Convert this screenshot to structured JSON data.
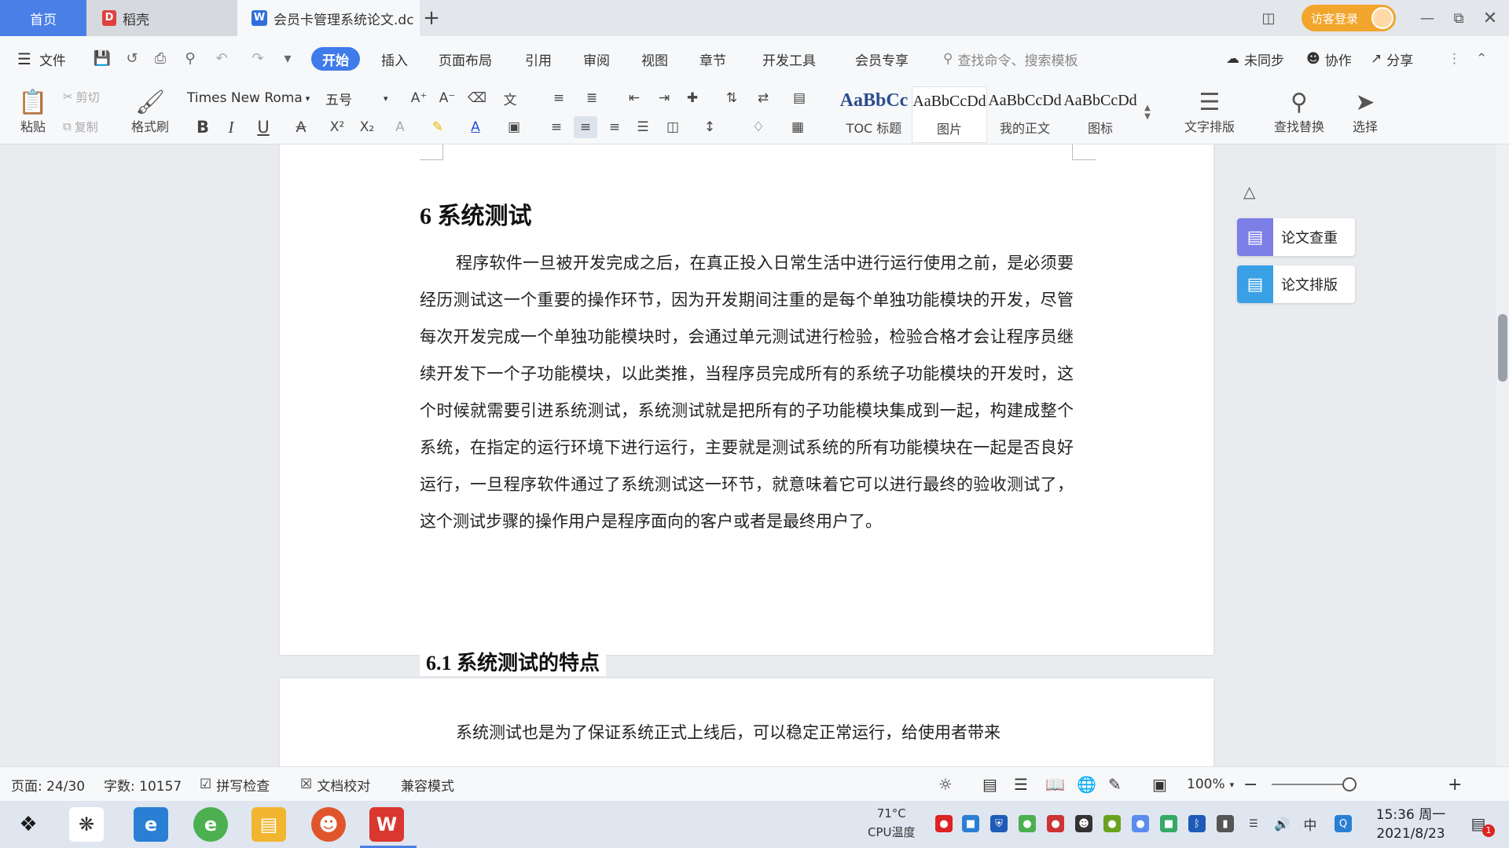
{
  "tabs": {
    "home": "首页",
    "daoke": "稻壳",
    "doc": "会员卡管理系统论文.dc",
    "add": "+",
    "login": "访客登录"
  },
  "menu": {
    "file": "文件",
    "items": [
      "开始",
      "插入",
      "页面布局",
      "引用",
      "审阅",
      "视图",
      "章节",
      "开发工具",
      "会员专享"
    ],
    "search": "查找命令、搜索模板",
    "unsynced": "未同步",
    "collab": "协作",
    "share": "分享"
  },
  "ribbon": {
    "paste": "粘贴",
    "cut": "剪切",
    "copy": "复制",
    "format_painter": "格式刷",
    "font_name": "Times New Roma",
    "font_size": "五号",
    "styles": [
      {
        "sample": "AaBbCc",
        "name": "TOC 标题"
      },
      {
        "sample": "AaBbCcDd",
        "name": "图片"
      },
      {
        "sample": "AaBbCcDd",
        "name": "我的正文"
      },
      {
        "sample": "AaBbCcDd",
        "name": "图标"
      }
    ],
    "text_layout": "文字排版",
    "find_replace": "查找替换",
    "select": "选择"
  },
  "document": {
    "heading": "6  系统测试",
    "paragraph": "程序软件一旦被开发完成之后，在真正投入日常生活中进行运行使用之前，是必须要经历测试这一个重要的操作环节，因为开发期间注重的是每个单独功能模块的开发，尽管每次开发完成一个单独功能模块时，会通过单元测试进行检验，检验合格才会让程序员继续开发下一个子功能模块，以此类推，当程序员完成所有的系统子功能模块的开发时，这个时候就需要引进系统测试，系统测试就是把所有的子功能模块集成到一起，构建成整个系统，在指定的运行环境下进行运行，主要就是测试系统的所有功能模块在一起是否良好运行，一旦程序软件通过了系统测试这一环节，就意味着它可以进行最终的验收测试了，这个测试步骤的操作用户是程序面向的客户或者是最终用户了。",
    "subheading": "6.1  系统测试的特点",
    "paragraph2": "系统测试也是为了保证系统正式上线后，可以稳定正常运行，给使用者带来"
  },
  "side_panel": {
    "check": "论文查重",
    "layout": "论文排版"
  },
  "status": {
    "page": "页面: 24/30",
    "words": "字数: 10157",
    "spell": "拼写检查",
    "proof": "文档校对",
    "compat": "兼容模式",
    "zoom": "100%",
    "zoom_level": 1.0
  },
  "taskbar": {
    "cpu_temp": "71°C",
    "cpu_label": "CPU温度",
    "ime": "中",
    "time": "15:36 周一",
    "date": "2021/8/23",
    "notif_count": "1"
  },
  "colors": {
    "accent": "#3f7bea",
    "login": "#f2a52c",
    "wps_red": "#d9372f"
  }
}
